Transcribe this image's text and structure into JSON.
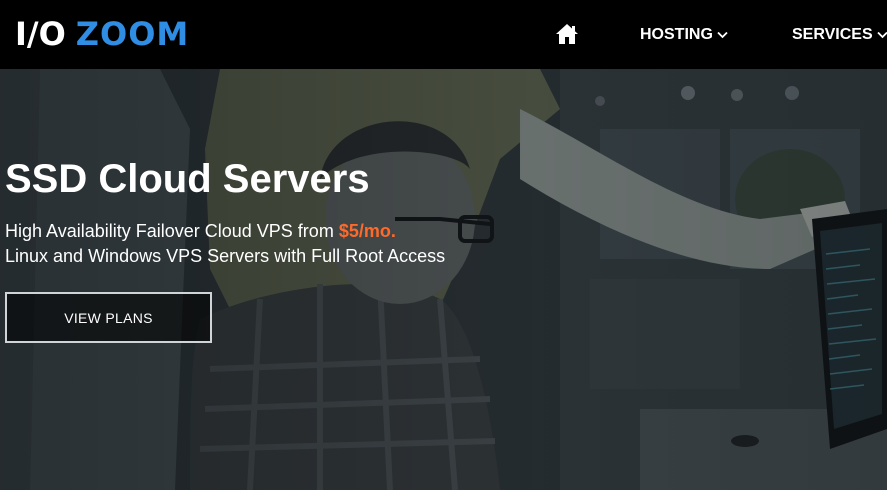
{
  "header": {
    "logo_io": "I/O",
    "logo_zoom": "ZOOM",
    "nav": [
      {
        "label": "HOSTING"
      },
      {
        "label": "SERVICES"
      }
    ]
  },
  "hero": {
    "title": "SSD Cloud Servers",
    "line1_prefix": "High Availability Failover Cloud VPS from ",
    "line1_price": "$5/mo.",
    "line2": "Linux and Windows VPS Servers with Full Root Access",
    "cta_label": "VIEW PLANS"
  },
  "colors": {
    "brand_blue": "#2f8de4",
    "price_orange": "#ff6a2b",
    "navbar_bg": "#000000"
  },
  "icons": {
    "home": "home-icon",
    "dropdown": "chevron-down-icon"
  }
}
